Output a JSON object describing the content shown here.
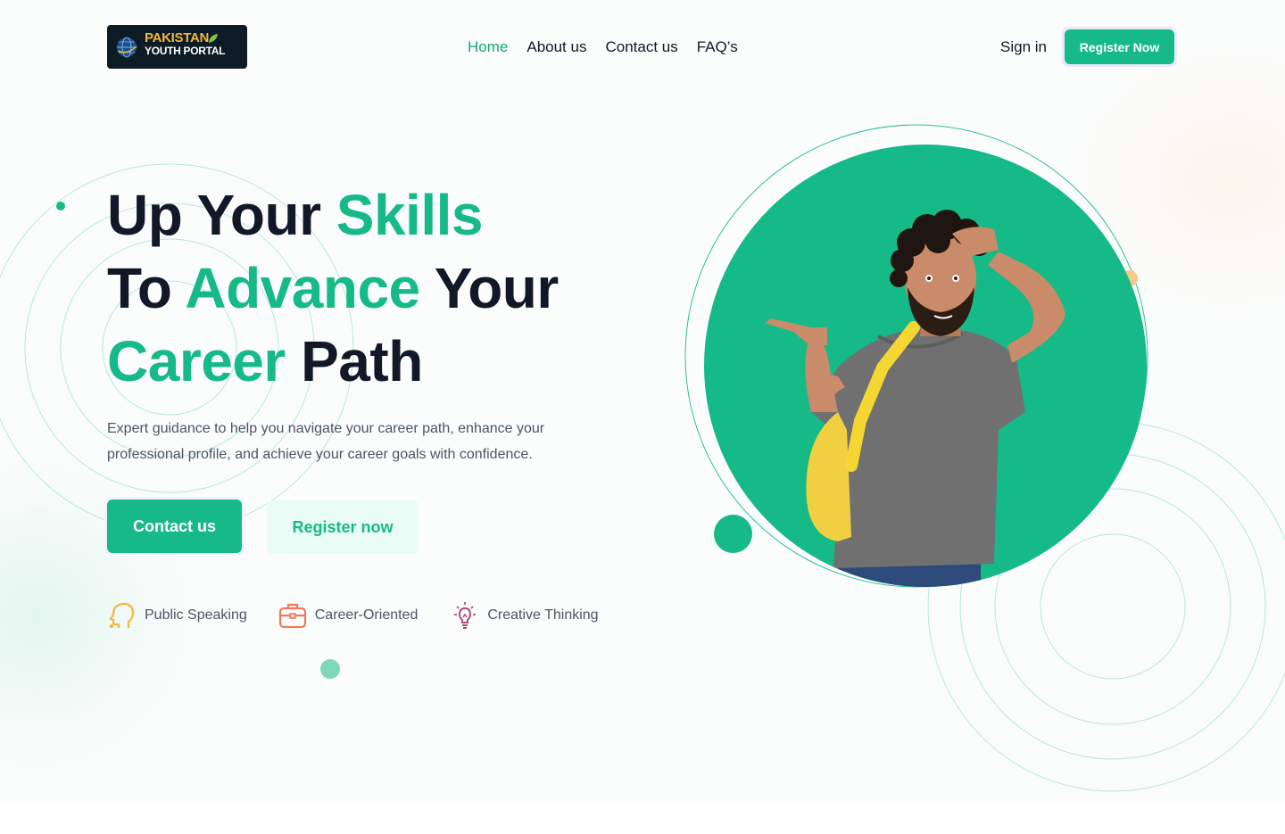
{
  "brand": {
    "logo_line1": "PAKISTAN",
    "logo_line2": "YOUTH PORTAL",
    "logo_icon": "globe-icon"
  },
  "nav": {
    "items": [
      {
        "label": "Home",
        "active": true
      },
      {
        "label": "About us",
        "active": false
      },
      {
        "label": "Contact us",
        "active": false
      },
      {
        "label": "FAQ’s",
        "active": false
      }
    ],
    "sign_in": "Sign in",
    "register": "Register Now"
  },
  "hero": {
    "title": {
      "w1": "Up Your ",
      "w2": "Skills",
      "w3": "To ",
      "w4": "Advance",
      "w5": " Your",
      "w6": "Career",
      "w7": " Path"
    },
    "description": "Expert guidance to help you navigate your career path, enhance your professional profile, and achieve your career goals with confidence.",
    "primary_button": "Contact us",
    "secondary_button": "Register now",
    "features": [
      {
        "label": "Public Speaking",
        "icon": "head-icon",
        "color": "#f5b73b"
      },
      {
        "label": "Career-Oriented",
        "icon": "briefcase-icon",
        "color": "#f07a5a"
      },
      {
        "label": "Creative Thinking",
        "icon": "lightbulb-icon",
        "color": "#b04a86"
      }
    ]
  },
  "colors": {
    "accent": "#16ba87",
    "accent_light": "#eafcf6",
    "text_dark": "#111827",
    "text_muted": "#4b5563"
  }
}
